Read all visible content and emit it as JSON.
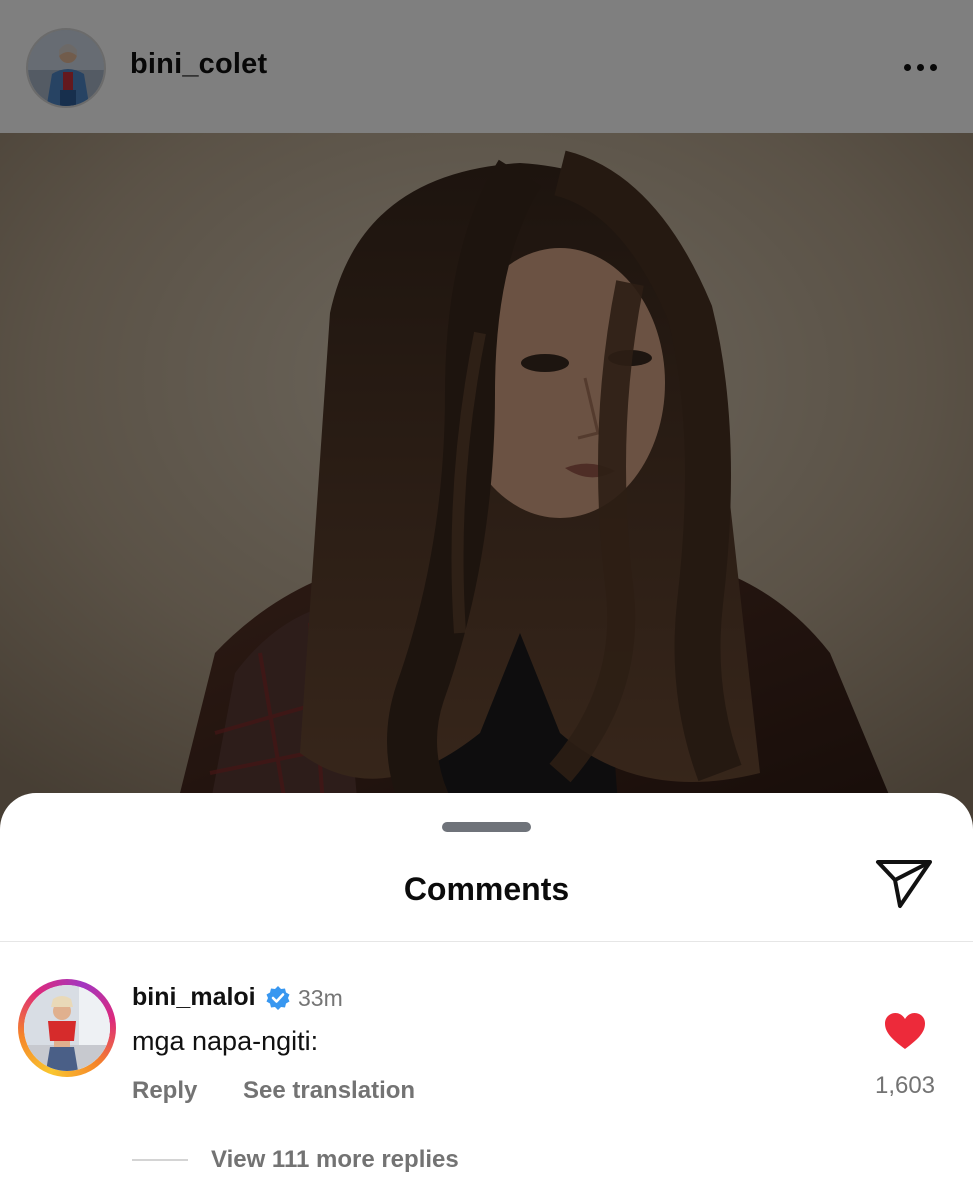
{
  "post": {
    "username": "bini_colet",
    "image_description_icon": "portrait-photo"
  },
  "comments_sheet": {
    "title": "Comments",
    "share_icon": "send-icon",
    "comment": {
      "username": "bini_maloi",
      "verified": true,
      "time": "33m",
      "text": "mga napa-ngiti:",
      "reply_label": "Reply",
      "translate_label": "See translation",
      "like_count": "1,603",
      "liked": true,
      "view_replies_label": "View 111 more replies"
    }
  },
  "colors": {
    "like_red": "#ed2a3a",
    "verified_blue": "#3897f0",
    "muted_text": "#737373"
  }
}
